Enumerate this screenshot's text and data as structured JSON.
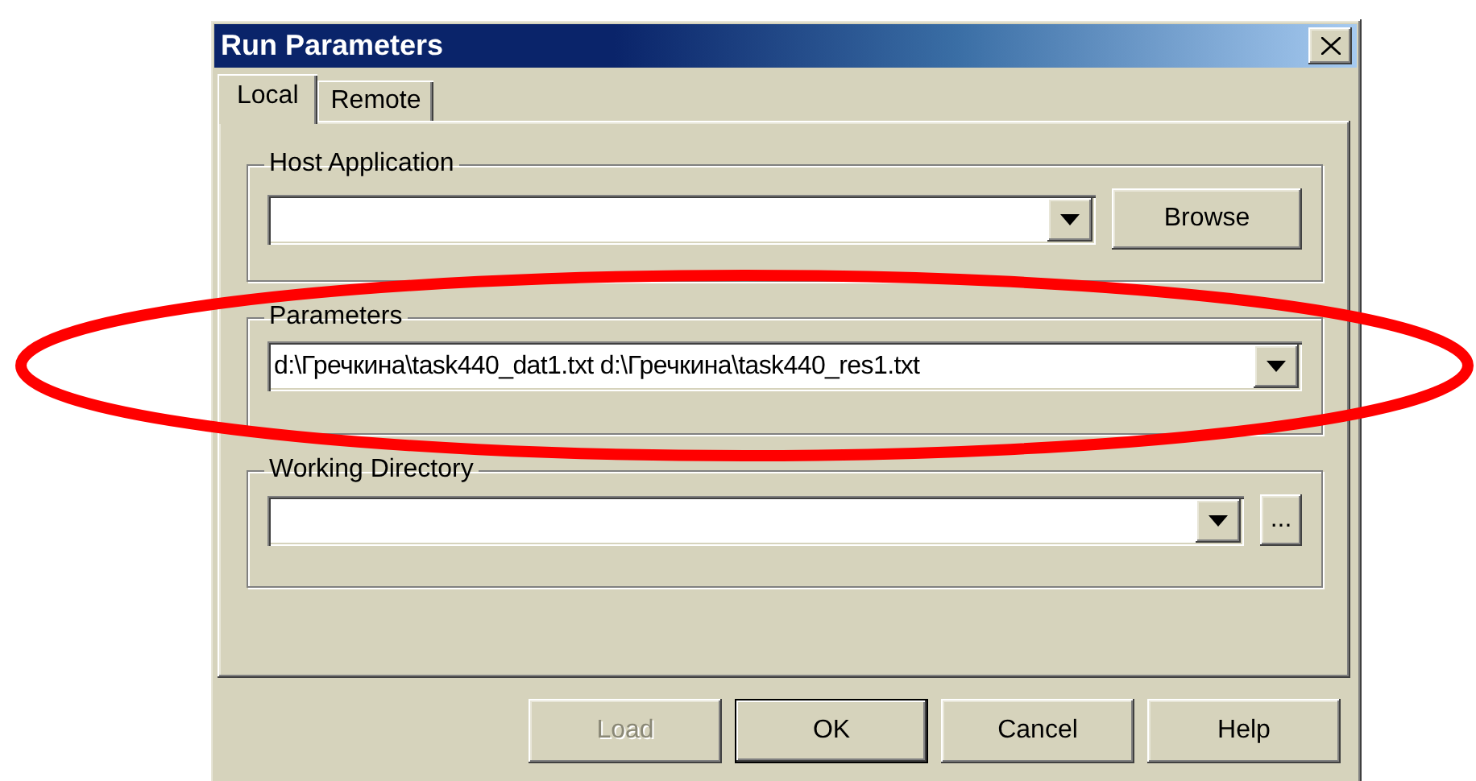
{
  "window": {
    "title": "Run Parameters"
  },
  "tabs": [
    {
      "label": "Local",
      "selected": true
    },
    {
      "label": "Remote",
      "selected": false
    }
  ],
  "groups": [
    {
      "label": "Host Application",
      "kind": "combo-button",
      "button": "Browse"
    },
    {
      "label": "Parameters",
      "kind": "combo",
      "value": "d:\\Гречкина\\task440_dat1.txt d:\\Гречкина\\task440_res1.txt"
    },
    {
      "label": "Working Directory",
      "kind": "combo-ellipsis",
      "button": "..."
    }
  ],
  "buttons": [
    {
      "label": "Load",
      "disabled": true,
      "default": false
    },
    {
      "label": "OK",
      "disabled": false,
      "default": true
    },
    {
      "label": "Cancel",
      "disabled": false,
      "default": false
    },
    {
      "label": "Help",
      "disabled": false,
      "default": false
    }
  ],
  "annotation": {
    "kind": "ellipse"
  }
}
